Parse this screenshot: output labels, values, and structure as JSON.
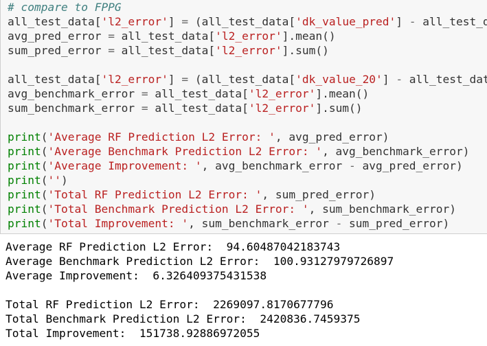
{
  "code_lines": [
    {
      "parts": [
        {
          "t": "# compare to FPPG",
          "c": "cm"
        }
      ]
    },
    {
      "parts": [
        {
          "t": "all_test_data[",
          "c": "p"
        },
        {
          "t": "'l2_error'",
          "c": "s1"
        },
        {
          "t": "] ",
          "c": "p"
        },
        {
          "t": "=",
          "c": "o"
        },
        {
          "t": " (all_test_data[",
          "c": "p"
        },
        {
          "t": "'dk_value_pred'",
          "c": "s1"
        },
        {
          "t": "] ",
          "c": "p"
        },
        {
          "t": "-",
          "c": "o"
        },
        {
          "t": " all_test_da",
          "c": "p"
        }
      ]
    },
    {
      "parts": [
        {
          "t": "avg_pred_error ",
          "c": "p"
        },
        {
          "t": "=",
          "c": "o"
        },
        {
          "t": " all_test_data[",
          "c": "p"
        },
        {
          "t": "'l2_error'",
          "c": "s1"
        },
        {
          "t": "].mean()",
          "c": "p"
        }
      ]
    },
    {
      "parts": [
        {
          "t": "sum_pred_error ",
          "c": "p"
        },
        {
          "t": "=",
          "c": "o"
        },
        {
          "t": " all_test_data[",
          "c": "p"
        },
        {
          "t": "'l2_error'",
          "c": "s1"
        },
        {
          "t": "].sum()",
          "c": "p"
        }
      ]
    },
    {
      "parts": [
        {
          "t": "",
          "c": "p"
        }
      ]
    },
    {
      "parts": [
        {
          "t": "all_test_data[",
          "c": "p"
        },
        {
          "t": "'l2_error'",
          "c": "s1"
        },
        {
          "t": "] ",
          "c": "p"
        },
        {
          "t": "=",
          "c": "o"
        },
        {
          "t": " (all_test_data[",
          "c": "p"
        },
        {
          "t": "'dk_value_20'",
          "c": "s1"
        },
        {
          "t": "] ",
          "c": "p"
        },
        {
          "t": "-",
          "c": "o"
        },
        {
          "t": " all_test_data",
          "c": "p"
        }
      ]
    },
    {
      "parts": [
        {
          "t": "avg_benchmark_error ",
          "c": "p"
        },
        {
          "t": "=",
          "c": "o"
        },
        {
          "t": " all_test_data[",
          "c": "p"
        },
        {
          "t": "'l2_error'",
          "c": "s1"
        },
        {
          "t": "].mean()",
          "c": "p"
        }
      ]
    },
    {
      "parts": [
        {
          "t": "sum_benchmark_error ",
          "c": "p"
        },
        {
          "t": "=",
          "c": "o"
        },
        {
          "t": " all_test_data[",
          "c": "p"
        },
        {
          "t": "'l2_error'",
          "c": "s1"
        },
        {
          "t": "].sum()",
          "c": "p"
        }
      ]
    },
    {
      "parts": [
        {
          "t": "",
          "c": "p"
        }
      ]
    },
    {
      "parts": [
        {
          "t": "print",
          "c": "nb"
        },
        {
          "t": "(",
          "c": "p"
        },
        {
          "t": "'Average RF Prediction L2 Error: '",
          "c": "s1"
        },
        {
          "t": ", avg_pred_error)",
          "c": "p"
        }
      ]
    },
    {
      "parts": [
        {
          "t": "print",
          "c": "nb"
        },
        {
          "t": "(",
          "c": "p"
        },
        {
          "t": "'Average Benchmark Prediction L2 Error: '",
          "c": "s1"
        },
        {
          "t": ", avg_benchmark_error)",
          "c": "p"
        }
      ]
    },
    {
      "parts": [
        {
          "t": "print",
          "c": "nb"
        },
        {
          "t": "(",
          "c": "p"
        },
        {
          "t": "'Average Improvement: '",
          "c": "s1"
        },
        {
          "t": ", avg_benchmark_error ",
          "c": "p"
        },
        {
          "t": "-",
          "c": "o"
        },
        {
          "t": " avg_pred_error)",
          "c": "p"
        }
      ]
    },
    {
      "parts": [
        {
          "t": "print",
          "c": "nb"
        },
        {
          "t": "(",
          "c": "p"
        },
        {
          "t": "''",
          "c": "s1"
        },
        {
          "t": ")",
          "c": "p"
        }
      ]
    },
    {
      "parts": [
        {
          "t": "print",
          "c": "nb"
        },
        {
          "t": "(",
          "c": "p"
        },
        {
          "t": "'Total RF Prediction L2 Error: '",
          "c": "s1"
        },
        {
          "t": ", sum_pred_error)",
          "c": "p"
        }
      ]
    },
    {
      "parts": [
        {
          "t": "print",
          "c": "nb"
        },
        {
          "t": "(",
          "c": "p"
        },
        {
          "t": "'Total Benchmark Prediction L2 Error: '",
          "c": "s1"
        },
        {
          "t": ", sum_benchmark_error)",
          "c": "p"
        }
      ]
    },
    {
      "parts": [
        {
          "t": "print",
          "c": "nb"
        },
        {
          "t": "(",
          "c": "p"
        },
        {
          "t": "'Total Improvement: '",
          "c": "s1"
        },
        {
          "t": ", sum_benchmark_error ",
          "c": "p"
        },
        {
          "t": "-",
          "c": "o"
        },
        {
          "t": " sum_pred_error)",
          "c": "p"
        }
      ]
    }
  ],
  "output_lines": [
    "Average RF Prediction L2 Error:  94.60487042183743",
    "Average Benchmark Prediction L2 Error:  100.93127979726897",
    "Average Improvement:  6.326409375431538",
    "",
    "Total RF Prediction L2 Error:  2269097.8170677796",
    "Total Benchmark Prediction L2 Error:  2420836.7459375",
    "Total Improvement:  151738.92886972055"
  ],
  "colors": {
    "input_background": "#f7f7f7",
    "comment": "#408080",
    "string": "#ba2121",
    "builtin": "#008000",
    "operator": "#666666"
  }
}
